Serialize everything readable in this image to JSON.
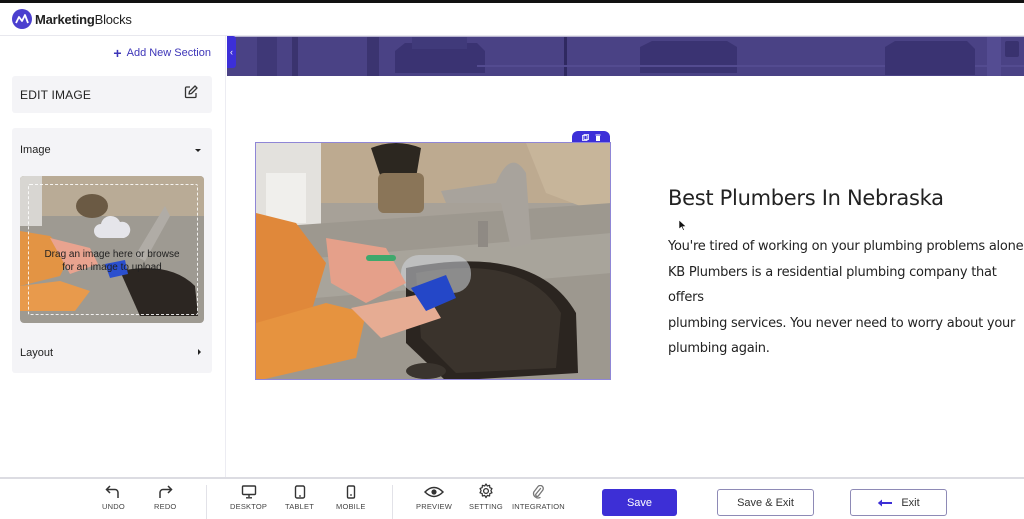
{
  "app": {
    "brand_bold": "Marketing",
    "brand_light": "Blocks",
    "brand_color": "#4b3fcf"
  },
  "sidebar": {
    "add_section_label": "Add New Section",
    "edit_title": "EDIT IMAGE",
    "sections": [
      {
        "label": "Image",
        "state": "expanded",
        "icon": "caret-down-icon"
      },
      {
        "label": "Layout",
        "state": "collapsed",
        "icon": "caret-right-icon"
      }
    ],
    "upload_message_line1": "Drag an image here or browse",
    "upload_message_line2": "for an image to upload"
  },
  "canvas": {
    "headline": "Best Plumbers In Nebraska",
    "body_lines": [
      "You're tired of working on your plumbing problems alone.",
      "KB Plumbers is a residential plumbing company that offers",
      "plumbing services. You never need to worry about your",
      "plumbing again."
    ],
    "image_tools": [
      "copy-icon",
      "trash-icon"
    ],
    "accent_color": "#3c2fd8",
    "banner_color": "#4a4285"
  },
  "toolbar": {
    "undo": "UNDO",
    "redo": "REDO",
    "desktop": "DESKTOP",
    "tablet": "TABLET",
    "mobile": "MOBILE",
    "preview": "PREVIEW",
    "setting": "SETTING",
    "integration": "INTEGRATION",
    "save": "Save",
    "save_exit": "Save & Exit",
    "exit": "Exit",
    "primary_color": "#3d2fd6"
  }
}
